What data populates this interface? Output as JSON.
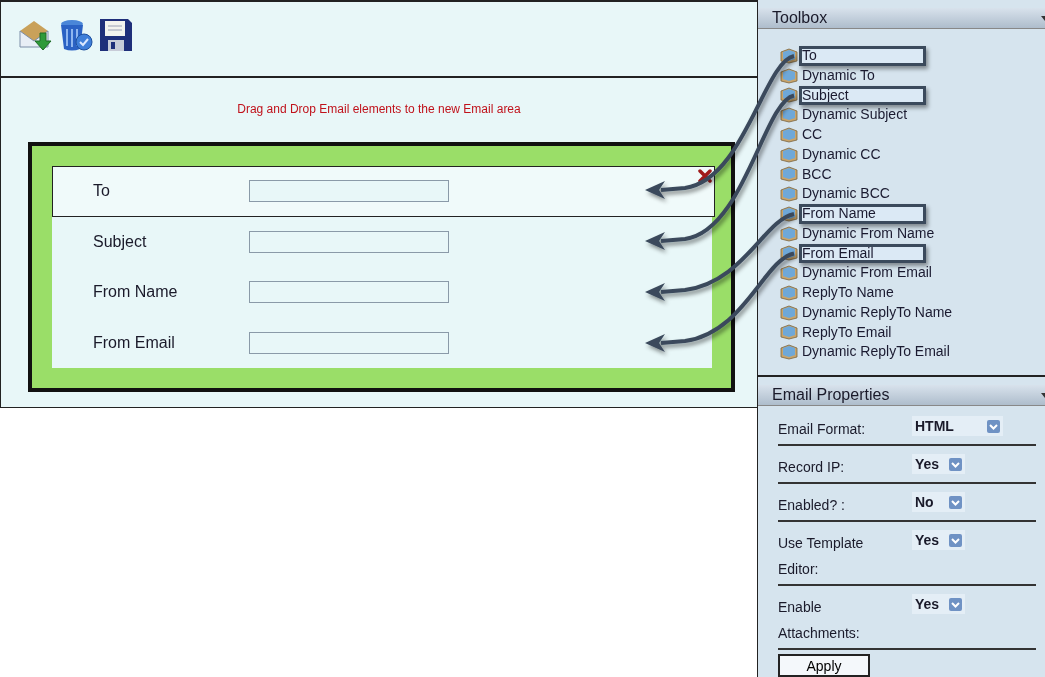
{
  "instruction": "Drag and Drop Email elements to the new Email area",
  "form_rows": [
    {
      "label": "To",
      "selected": true,
      "arrow_in": true
    },
    {
      "label": "Subject",
      "selected": false,
      "arrow_in": true
    },
    {
      "label": "From Name",
      "selected": false,
      "arrow_in": true
    },
    {
      "label": "From Email",
      "selected": false,
      "arrow_in": true
    }
  ],
  "toolbox": {
    "title": "Toolbox",
    "items": [
      {
        "label": "To",
        "highlighted": true
      },
      {
        "label": "Dynamic To",
        "highlighted": false
      },
      {
        "label": "Subject",
        "highlighted": true
      },
      {
        "label": "Dynamic Subject",
        "highlighted": false
      },
      {
        "label": "CC",
        "highlighted": false
      },
      {
        "label": "Dynamic CC",
        "highlighted": false
      },
      {
        "label": "BCC",
        "highlighted": false
      },
      {
        "label": "Dynamic BCC",
        "highlighted": false
      },
      {
        "label": "From Name",
        "highlighted": true
      },
      {
        "label": "Dynamic From Name",
        "highlighted": false
      },
      {
        "label": "From Email",
        "highlighted": true
      },
      {
        "label": "Dynamic From Email",
        "highlighted": false
      },
      {
        "label": "ReplyTo Name",
        "highlighted": false
      },
      {
        "label": "Dynamic ReplyTo Name",
        "highlighted": false
      },
      {
        "label": "ReplyTo Email",
        "highlighted": false
      },
      {
        "label": "Dynamic ReplyTo Email",
        "highlighted": false
      }
    ]
  },
  "properties": {
    "title": "Email Properties",
    "fields": [
      {
        "label": "Email Format:",
        "value": "HTML"
      },
      {
        "label": "Record IP:",
        "value": "Yes"
      },
      {
        "label": "Enabled? :",
        "value": "No"
      },
      {
        "label": "Use Template Editor:",
        "value": "Yes"
      },
      {
        "label": "Enable Attachments:",
        "value": "Yes"
      }
    ],
    "apply": "Apply"
  }
}
